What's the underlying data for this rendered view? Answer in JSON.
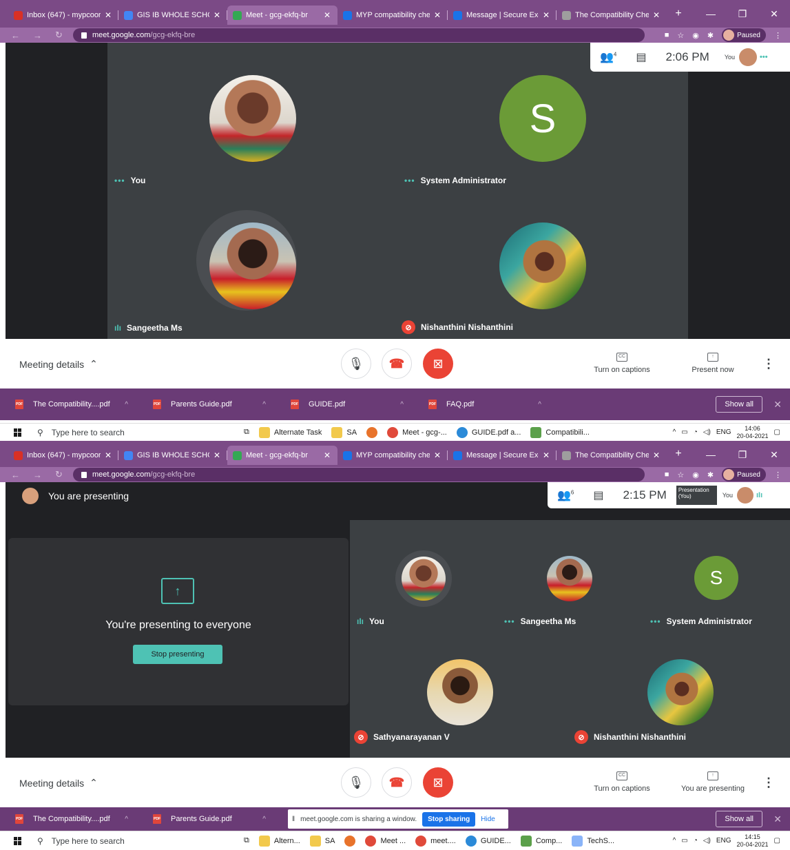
{
  "browser": {
    "tabs": [
      {
        "title": "Inbox (647) - mypcoordi",
        "color": "#d93025"
      },
      {
        "title": "GIS IB WHOLE SCHOOL",
        "color": "#4285f4"
      },
      {
        "title": "Meet - gcg-ekfq-br",
        "color": "#34a853"
      },
      {
        "title": "MYP compatibility chec",
        "color": "#1a73e8"
      },
      {
        "title": "Message | Secure Excha",
        "color": "#1a73e8"
      },
      {
        "title": "The Compatibility Chec",
        "color": "#9e9e9e"
      }
    ],
    "url_host": "meet.google.com",
    "url_path": "/gcg-ekfq-bre",
    "paused_label": "Paused",
    "close_glyph": "✕",
    "new_tab_glyph": "+"
  },
  "shot1": {
    "participants_count": "4",
    "time": "2:06 PM",
    "you_label": "You",
    "tiles": [
      {
        "name": "You",
        "indicator": "dots"
      },
      {
        "name": "System Administrator",
        "indicator": "dots",
        "letter": "S"
      },
      {
        "name": "Sangeetha Ms",
        "indicator": "bars"
      },
      {
        "name": "Nishanthini Nishanthini",
        "indicator": "muted"
      }
    ]
  },
  "shot2": {
    "header": "You are presenting",
    "participants_count": "6",
    "time": "2:15 PM",
    "you_label": "You",
    "presentation_thumb": "Presentation (You)",
    "presenting_text": "You're presenting to everyone",
    "stop_presenting": "Stop presenting",
    "tiles": [
      {
        "name": "You",
        "indicator": "bars"
      },
      {
        "name": "Sangeetha Ms",
        "indicator": "dots"
      },
      {
        "name": "System Administrator",
        "indicator": "dots",
        "letter": "S"
      },
      {
        "name": "Sathyanarayanan V",
        "indicator": "muted"
      },
      {
        "name": "Nishanthini Nishanthini",
        "indicator": "muted"
      }
    ]
  },
  "controls": {
    "meeting_details": "Meeting details",
    "captions": "Turn on captions",
    "present_now": "Present now",
    "you_are_presenting": "You are presenting"
  },
  "downloads1": {
    "items": [
      "The Compatibility....pdf",
      "Parents Guide.pdf",
      "GUIDE.pdf",
      "FAQ.pdf"
    ],
    "show_all": "Show all"
  },
  "downloads2": {
    "items": [
      "The Compatibility....pdf",
      "Parents Guide.pdf"
    ],
    "show_all": "Show all",
    "sharing_msg": "meet.google.com is sharing a window.",
    "stop_sharing": "Stop sharing",
    "hide": "Hide"
  },
  "taskbar1": {
    "search": "Type here to search",
    "apps": [
      "Alternate Task",
      "SA",
      "Meet - gcg-...",
      "GUIDE.pdf a...",
      "Compatibili..."
    ],
    "lang": "ENG",
    "time": "14:06",
    "date": "20-04-2021"
  },
  "taskbar2": {
    "search": "Type here to search",
    "apps": [
      "Altern...",
      "SA",
      "Meet ...",
      "meet....",
      "GUIDE...",
      "Comp...",
      "TechS..."
    ],
    "lang": "ENG",
    "time": "14:15",
    "date": "20-04-2021"
  },
  "colors": {
    "accent": "#4ec2b4",
    "danger": "#ea4335",
    "chrome": "#7b4a86",
    "meet_bg": "#202124",
    "tile_bg": "#3c4043",
    "avatar_green": "#6b9b37"
  }
}
